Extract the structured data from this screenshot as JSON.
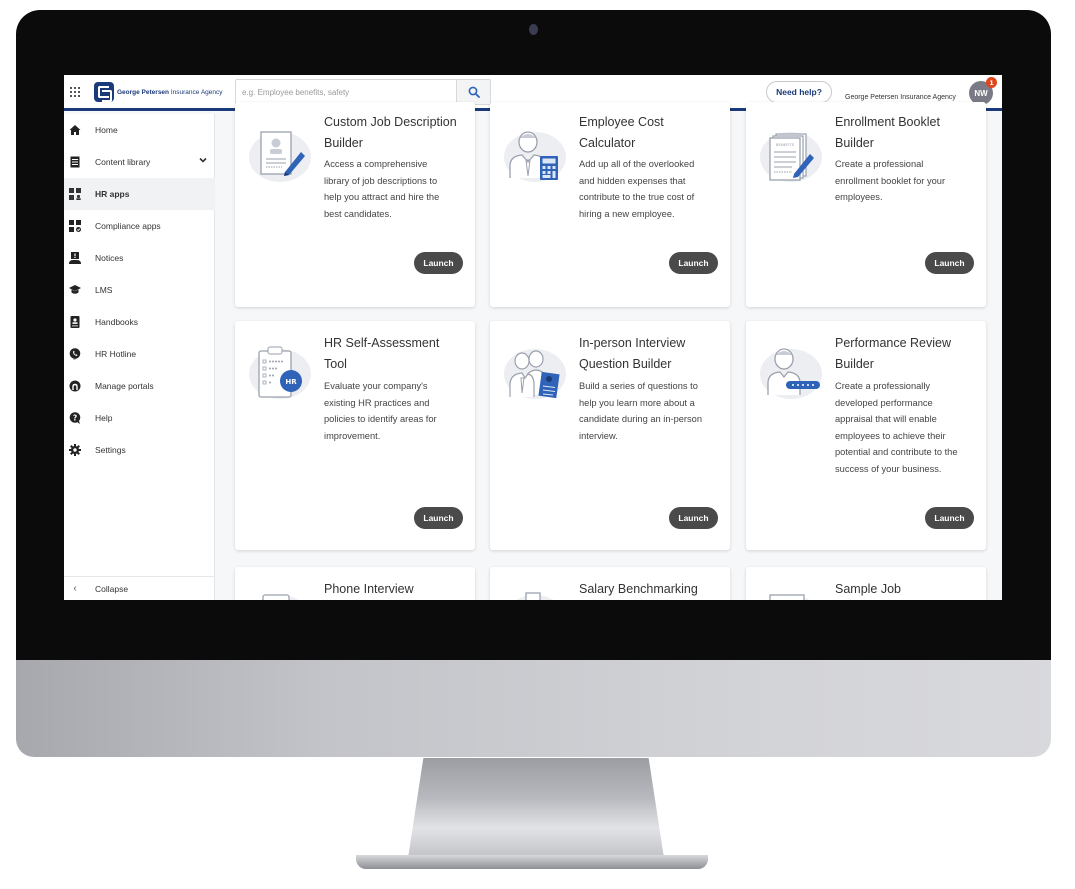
{
  "header": {
    "logo_bold": "George Petersen",
    "logo_rest": " Insurance Agency",
    "search_placeholder": "e.g. Employee benefits, safety",
    "help_label": "Need help?",
    "org_name": "George Petersen Insurance Agency",
    "avatar_initials": "NW",
    "notification_count": "1"
  },
  "sidebar": {
    "items": [
      {
        "label": "Home",
        "icon": "home-icon"
      },
      {
        "label": "Content library",
        "icon": "document-list-icon",
        "expandable": true
      },
      {
        "label": "HR apps",
        "icon": "apps-grid-icon",
        "active": true
      },
      {
        "label": "Compliance apps",
        "icon": "compliance-grid-icon"
      },
      {
        "label": "Notices",
        "icon": "notice-icon"
      },
      {
        "label": "LMS",
        "icon": "graduation-cap-icon"
      },
      {
        "label": "Handbooks",
        "icon": "handbook-icon"
      },
      {
        "label": "HR Hotline",
        "icon": "phone-icon"
      },
      {
        "label": "Manage portals",
        "icon": "portal-icon"
      },
      {
        "label": "Help",
        "icon": "help-icon"
      },
      {
        "label": "Settings",
        "icon": "gear-icon"
      }
    ],
    "collapse_label": "Collapse"
  },
  "cards": [
    {
      "title": "Custom Job Description Builder",
      "description": "Access a comprehensive library of job descriptions to help you attract and hire the best candidates.",
      "button": "Launch",
      "icon": "job-description-icon"
    },
    {
      "title": "Employee Cost Calculator",
      "description": "Add up all of the overlooked and hidden expenses that contribute to the true cost of hiring a new employee.",
      "button": "Launch",
      "icon": "calculator-icon"
    },
    {
      "title": "Enrollment Booklet Builder",
      "description": "Create a professional enrollment booklet for your employees.",
      "button": "Launch",
      "icon": "booklet-icon",
      "icon_label": "BENEFITS"
    },
    {
      "title": "HR Self-Assessment Tool",
      "description": "Evaluate your company's existing HR practices and policies to identify areas for improvement.",
      "button": "Launch",
      "icon": "clipboard-icon",
      "icon_label": "HR"
    },
    {
      "title": "In-person Interview Question Builder",
      "description": "Build a series of questions to help you learn more about a candidate during an in-person interview.",
      "button": "Launch",
      "icon": "interview-icon"
    },
    {
      "title": "Performance Review Builder",
      "description": "Create a professionally developed performance appraisal that will enable employees to achieve their potential and contribute to the success of your business.",
      "button": "Launch",
      "icon": "performance-icon"
    },
    {
      "title": "Phone Interview",
      "icon": "phone-interview-icon"
    },
    {
      "title": "Salary Benchmarking",
      "icon": "salary-icon"
    },
    {
      "title": "Sample Job",
      "icon": "sample-job-icon"
    }
  ],
  "colors": {
    "brand": "#1a3a7a",
    "accent_blue": "#2e63b8",
    "launch_button": "#4a4a4a",
    "notification": "#e0461d"
  }
}
